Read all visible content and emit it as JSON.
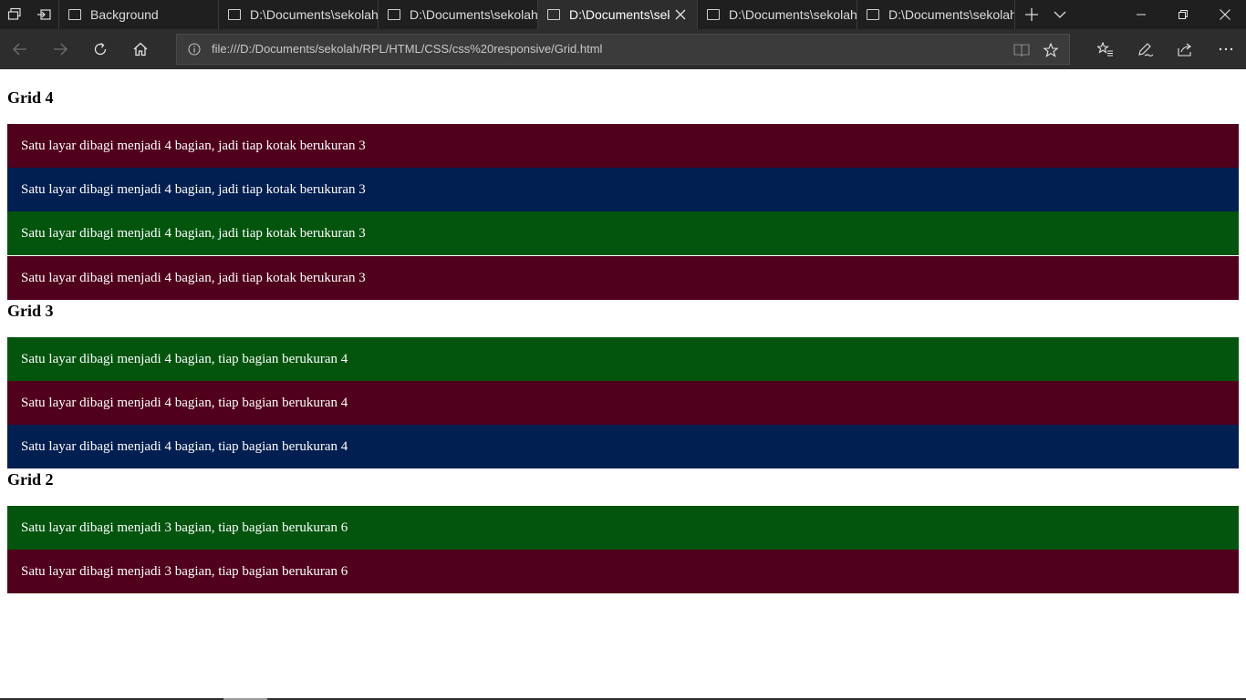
{
  "browser": {
    "tabs": [
      {
        "title": "Background"
      },
      {
        "title": "D:\\Documents\\sekolah\\"
      },
      {
        "title": "D:\\Documents\\sekolah\\"
      },
      {
        "title": "D:\\Documents\\seko"
      },
      {
        "title": "D:\\Documents\\sekolah\\"
      },
      {
        "title": "D:\\Documents\\sekolah\\"
      }
    ],
    "address": "file:///D:/Documents/sekolah/RPL/HTML/CSS/css%20responsive/Grid.html"
  },
  "page": {
    "sections": [
      {
        "title": "Grid 4",
        "boxes": [
          {
            "text": "Satu layar dibagi menjadi 4 bagian, jadi tiap kotak berukuran 3",
            "color": "#50001c"
          },
          {
            "text": "Satu layar dibagi menjadi 4 bagian, jadi tiap kotak berukuran 3",
            "color": "#011f50"
          },
          {
            "text": "Satu layar dibagi menjadi 4 bagian, jadi tiap kotak berukuran 3",
            "color": "#03550e"
          },
          {
            "text": "Satu layar dibagi menjadi 4 bagian, jadi tiap kotak berukuran 3",
            "color": "#50001c"
          }
        ]
      },
      {
        "title": "Grid 3",
        "boxes": [
          {
            "text": "Satu layar dibagi menjadi 4 bagian, tiap bagian berukuran 4",
            "color": "#03550e"
          },
          {
            "text": "Satu layar dibagi menjadi 4 bagian, tiap bagian berukuran 4",
            "color": "#50001c"
          },
          {
            "text": "Satu layar dibagi menjadi 4 bagian, tiap bagian berukuran 4",
            "color": "#011f50"
          }
        ]
      },
      {
        "title": "Grid 2",
        "boxes": [
          {
            "text": "Satu layar dibagi menjadi 3 bagian, tiap bagian berukuran 6",
            "color": "#03550e"
          },
          {
            "text": "Satu layar dibagi menjadi 3 bagian, tiap bagian berukuran 6",
            "color": "#50001c"
          }
        ]
      }
    ]
  }
}
